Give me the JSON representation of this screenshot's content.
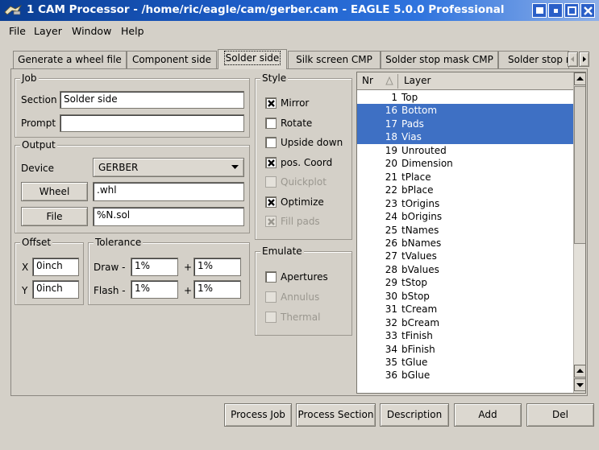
{
  "window": {
    "title": "1 CAM Processor - /home/ric/eagle/cam/gerber.cam - EAGLE 5.0.0 Professional",
    "controls": [
      "minimize-icon",
      "restore-icon",
      "maximize-icon",
      "close-icon"
    ]
  },
  "menu": {
    "file": "File",
    "layer": "Layer",
    "window": "Window",
    "help": "Help"
  },
  "tabs": [
    {
      "label": "Generate a wheel file"
    },
    {
      "label": "Component side"
    },
    {
      "label": "Solder side",
      "active": true
    },
    {
      "label": "Silk screen CMP"
    },
    {
      "label": "Solder stop mask CMP"
    },
    {
      "label": "Solder stop m"
    }
  ],
  "job": {
    "title": "Job",
    "section_label": "Section",
    "section_value": "Solder side",
    "prompt_label": "Prompt",
    "prompt_value": ""
  },
  "output": {
    "title": "Output",
    "device_label": "Device",
    "device_value": "GERBER",
    "wheel_button": "Wheel",
    "wheel_value": ".whl",
    "file_button": "File",
    "file_value": "%N.sol"
  },
  "offset": {
    "title": "Offset",
    "x_label": "X",
    "x_value": "0inch",
    "y_label": "Y",
    "y_value": "0inch"
  },
  "tolerance": {
    "title": "Tolerance",
    "draw_label": "Draw -",
    "draw_minus": "1%",
    "draw_plus_label": "+",
    "draw_plus": "1%",
    "flash_label": "Flash -",
    "flash_minus": "1%",
    "flash_plus_label": "+",
    "flash_plus": "1%"
  },
  "style": {
    "title": "Style",
    "options": [
      {
        "label": "Mirror",
        "checked": true,
        "enabled": true
      },
      {
        "label": "Rotate",
        "checked": false,
        "enabled": true
      },
      {
        "label": "Upside down",
        "checked": false,
        "enabled": true
      },
      {
        "label": "pos. Coord",
        "checked": true,
        "enabled": true
      },
      {
        "label": "Quickplot",
        "checked": false,
        "enabled": false
      },
      {
        "label": "Optimize",
        "checked": true,
        "enabled": true
      },
      {
        "label": "Fill pads",
        "checked": true,
        "enabled": false
      }
    ]
  },
  "emulate": {
    "title": "Emulate",
    "options": [
      {
        "label": "Apertures",
        "checked": false,
        "enabled": true
      },
      {
        "label": "Annulus",
        "checked": false,
        "enabled": false
      },
      {
        "label": "Thermal",
        "checked": false,
        "enabled": false
      }
    ]
  },
  "layers": {
    "header_nr": "Nr",
    "header_layer": "Layer",
    "rows": [
      {
        "nr": "1",
        "name": "Top",
        "selected": false
      },
      {
        "nr": "16",
        "name": "Bottom",
        "selected": true
      },
      {
        "nr": "17",
        "name": "Pads",
        "selected": true
      },
      {
        "nr": "18",
        "name": "Vias",
        "selected": true
      },
      {
        "nr": "19",
        "name": "Unrouted",
        "selected": false
      },
      {
        "nr": "20",
        "name": "Dimension",
        "selected": false
      },
      {
        "nr": "21",
        "name": "tPlace",
        "selected": false
      },
      {
        "nr": "22",
        "name": "bPlace",
        "selected": false
      },
      {
        "nr": "23",
        "name": "tOrigins",
        "selected": false
      },
      {
        "nr": "24",
        "name": "bOrigins",
        "selected": false
      },
      {
        "nr": "25",
        "name": "tNames",
        "selected": false
      },
      {
        "nr": "26",
        "name": "bNames",
        "selected": false
      },
      {
        "nr": "27",
        "name": "tValues",
        "selected": false
      },
      {
        "nr": "28",
        "name": "bValues",
        "selected": false
      },
      {
        "nr": "29",
        "name": "tStop",
        "selected": false
      },
      {
        "nr": "30",
        "name": "bStop",
        "selected": false
      },
      {
        "nr": "31",
        "name": "tCream",
        "selected": false
      },
      {
        "nr": "32",
        "name": "bCream",
        "selected": false
      },
      {
        "nr": "33",
        "name": "tFinish",
        "selected": false
      },
      {
        "nr": "34",
        "name": "bFinish",
        "selected": false
      },
      {
        "nr": "35",
        "name": "tGlue",
        "selected": false
      },
      {
        "nr": "36",
        "name": "bGlue",
        "selected": false
      }
    ]
  },
  "actions": {
    "process_job": "Process Job",
    "process_section": "Process Section",
    "description": "Description",
    "add": "Add",
    "del": "Del"
  },
  "colors": {
    "selection": "#3e70c4",
    "titlebar": "#1c5cc6",
    "background": "#d4d0c8"
  }
}
